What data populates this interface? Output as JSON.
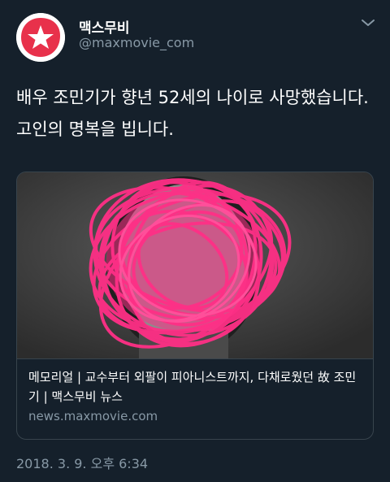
{
  "account": {
    "display_name": "맥스무비",
    "handle": "@maxmovie_com",
    "avatar_icon": "red-star-logo-icon",
    "brand_color": "#e8314b"
  },
  "tweet": {
    "text": "배우 조민기가 향년 52세의 나이로 사망했습니다. 고인의 명복을 빕니다.",
    "timestamp": "2018. 3. 9. 오후 6:34"
  },
  "card": {
    "image_description_icon": "scribbled-out-photo",
    "scribble_color": "#ff2f86",
    "title": "메모리얼 | 교수부터 외팔이 피아니스트까지, 다채로웠던 故 조민기 | 맥스무비 뉴스",
    "domain": "news.maxmovie.com"
  },
  "menu": {
    "caret_icon": "chevron-down-icon"
  },
  "colors": {
    "background": "#15202b",
    "secondary_text": "#8899a6",
    "border": "#38444d"
  }
}
